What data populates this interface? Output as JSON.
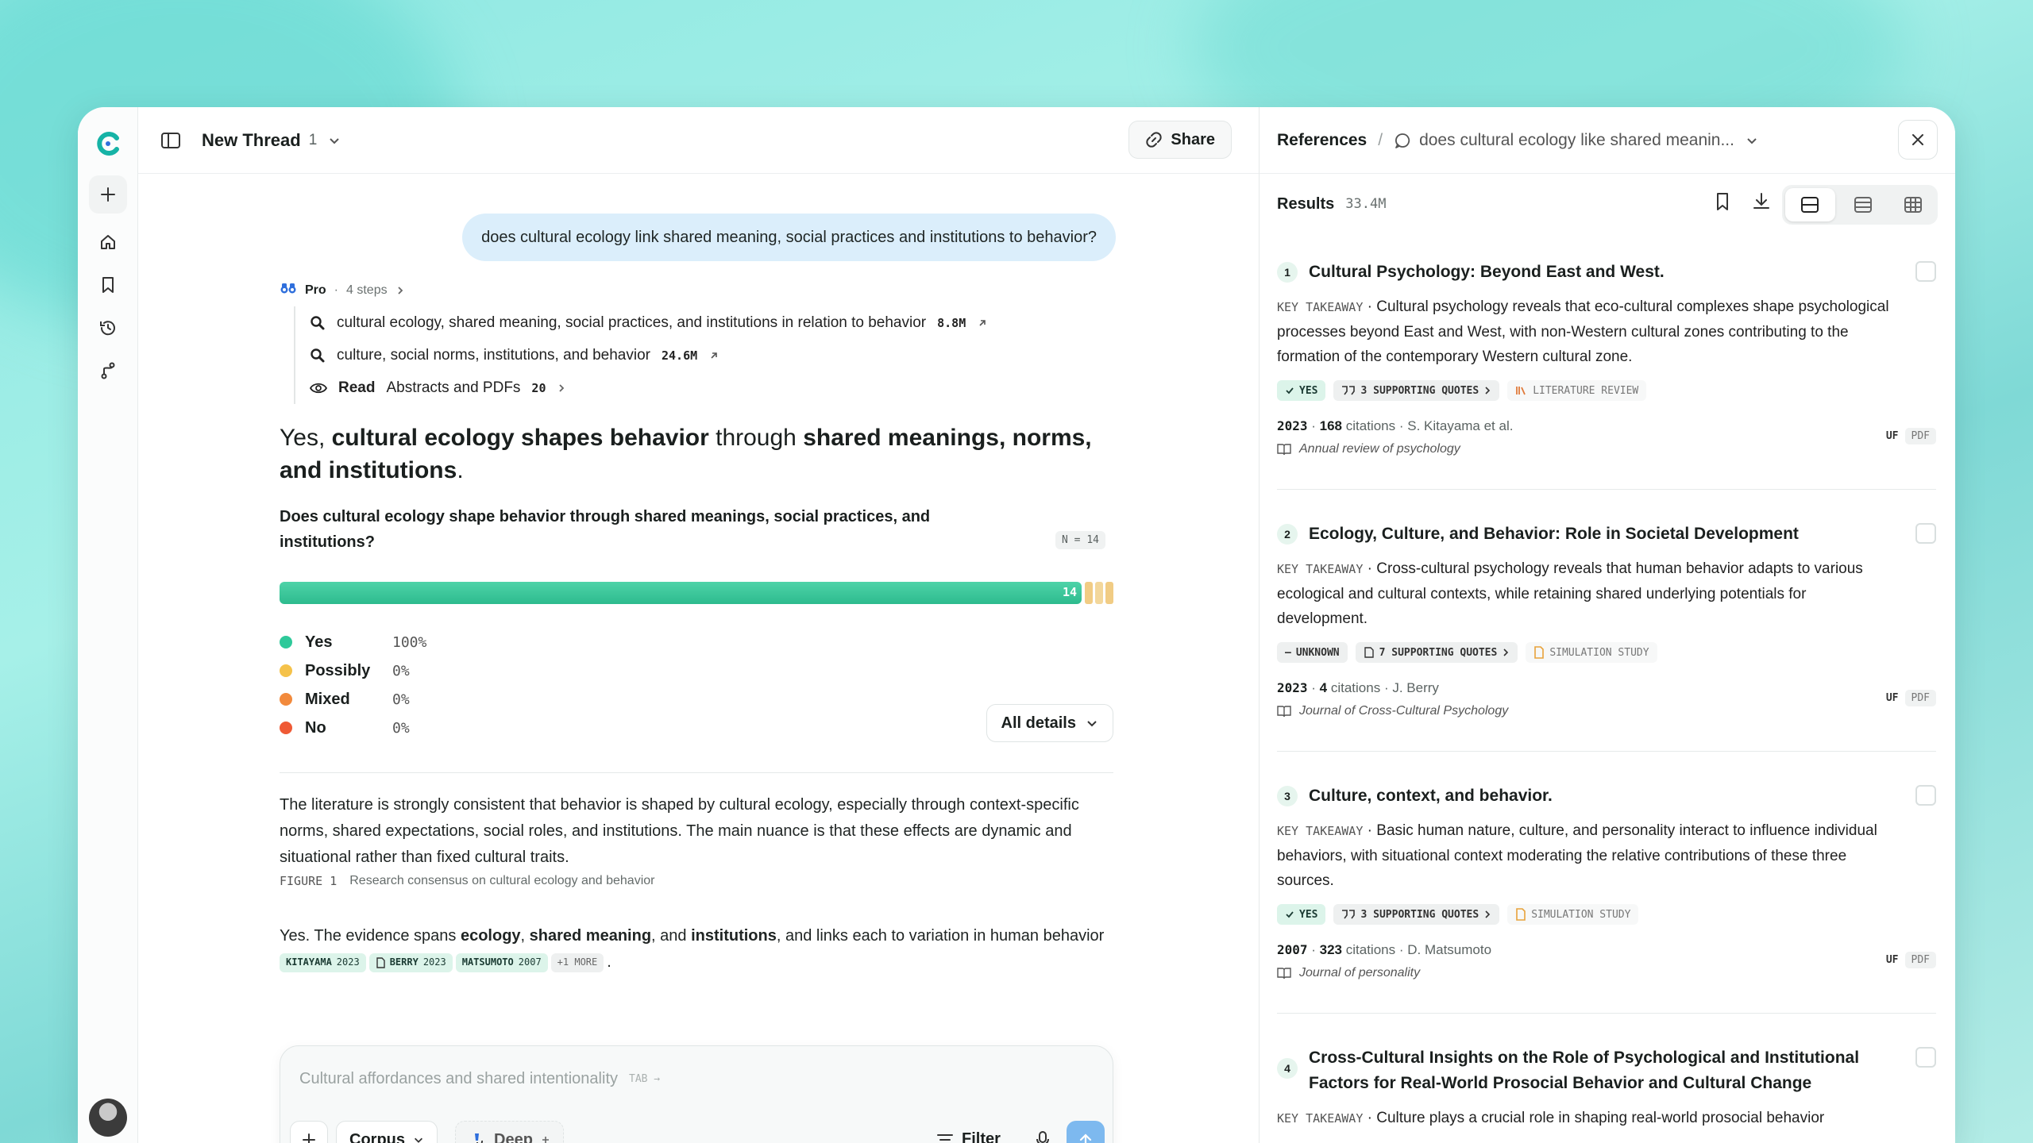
{
  "header": {
    "thread_title": "New Thread",
    "thread_count": "1",
    "share_label": "Share"
  },
  "query": "does cultural ecology link shared meaning, social practices and institutions to behavior?",
  "pro": {
    "label": "Pro",
    "steps_label": "4 steps",
    "steps": [
      {
        "text": "cultural ecology, shared meaning, social practices, and institutions in relation to behavior",
        "count": "8.8M"
      },
      {
        "text": "culture, social norms, institutions, and behavior",
        "count": "24.6M"
      }
    ],
    "read": {
      "label": "Read",
      "text": "Abstracts and PDFs",
      "count": "20"
    }
  },
  "answer": {
    "headline_parts": [
      "Yes, ",
      "cultural ecology shapes behavior",
      " through ",
      "shared meanings, norms, and institutions",
      "."
    ],
    "question": "Does cultural ecology shape behavior through shared meanings, social practices, and institutions?",
    "n_badge": "N = 14",
    "bar_count": "14",
    "consensus": [
      {
        "label": "Yes",
        "value": "100%",
        "color": "#2ec99a",
        "fraction": 1.0
      },
      {
        "label": "Possibly",
        "value": "0%",
        "color": "#f5c24a",
        "fraction": 0
      },
      {
        "label": "Mixed",
        "value": "0%",
        "color": "#f28a3c",
        "fraction": 0
      },
      {
        "label": "No",
        "value": "0%",
        "color": "#ef5a35",
        "fraction": 0
      }
    ],
    "details_label": "All details",
    "paragraph": "The literature is strongly consistent that behavior is shaped by cultural ecology, especially through context-specific norms, shared expectations, social roles, and institutions. The main nuance is that these effects are dynamic and situational rather than fixed cultural traits.",
    "figure_label": "FIGURE 1",
    "figure_caption": "Research consensus on cultural ecology and behavior",
    "evidence_parts": [
      "Yes. The evidence spans ",
      "ecology",
      ", ",
      "shared meaning",
      ", and ",
      "institutions",
      ", and links each to variation in human behavior "
    ],
    "citations": [
      {
        "name": "KITAYAMA",
        "year": "2023"
      },
      {
        "name": "BERRY",
        "year": "2023"
      },
      {
        "name": "MATSUMOTO",
        "year": "2007"
      }
    ],
    "more_label": "+1 MORE"
  },
  "composer": {
    "placeholder": "Cultural affordances and shared intentionality",
    "tab_hint": "TAB →",
    "corpus_label": "Corpus",
    "deep_label": "Deep",
    "filter_label": "Filter"
  },
  "references": {
    "title": "References",
    "query_short": "does cultural ecology like shared meanin...",
    "results_label": "Results",
    "results_count": "33.4M",
    "key_takeaway_label": "KEY TAKEAWAY",
    "items": [
      {
        "num": "1",
        "title": "Cultural Psychology: Beyond East and West.",
        "takeaway": "Cultural psychology reveals that eco-cultural complexes shape psychological processes beyond East and West, with non-Western cultural zones contributing to the formation of the contemporary Western cultural zone.",
        "verdict": "YES",
        "quotes": "3 SUPPORTING QUOTES",
        "study_type": "LITERATURE REVIEW",
        "year": "2023",
        "citations": "168",
        "citations_label": "citations",
        "authors": "S. Kitayama et al.",
        "journal": "Annual review of psychology",
        "uf": "UF",
        "pdf": "PDF"
      },
      {
        "num": "2",
        "title": "Ecology, Culture, and Behavior: Role in Societal Development",
        "takeaway": "Cross-cultural psychology reveals that human behavior adapts to various ecological and cultural contexts, while retaining shared underlying potentials for development.",
        "verdict": "UNKNOWN",
        "quotes": "7 SUPPORTING QUOTES",
        "study_type": "SIMULATION STUDY",
        "year": "2023",
        "citations": "4",
        "citations_label": "citations",
        "authors": "J. Berry",
        "journal": "Journal of Cross-Cultural Psychology",
        "uf": "UF",
        "pdf": "PDF"
      },
      {
        "num": "3",
        "title": "Culture, context, and behavior.",
        "takeaway": "Basic human nature, culture, and personality interact to influence individual behaviors, with situational context moderating the relative contributions of these three sources.",
        "verdict": "YES",
        "quotes": "3 SUPPORTING QUOTES",
        "study_type": "SIMULATION STUDY",
        "year": "2007",
        "citations": "323",
        "citations_label": "citations",
        "authors": "D. Matsumoto",
        "journal": "Journal of personality",
        "uf": "UF",
        "pdf": "PDF"
      },
      {
        "num": "4",
        "title": "Cross-Cultural Insights on the Role of Psychological and Institutional Factors for Real-World Prosocial Behavior and Cultural Change",
        "takeaway": "Culture plays a crucial role in shaping real-world prosocial behavior"
      }
    ]
  }
}
